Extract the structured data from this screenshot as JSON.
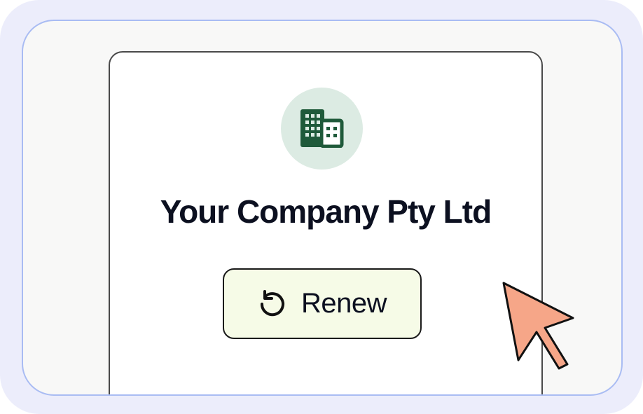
{
  "card": {
    "icon": "building-icon",
    "company_name": "Your Company Pty Ltd",
    "renew_button": {
      "label": "Renew",
      "icon": "rotate-ccw-icon"
    }
  },
  "pointer": {
    "icon": "mouse-pointer-icon",
    "color": "#f6a688"
  },
  "colors": {
    "frame_background": "#ecedfb",
    "frame_border": "#a9bcf3",
    "avatar_background": "#dcebe3",
    "building_icon": "#1f5a3a",
    "button_background": "#f6fbe7",
    "text": "#0c1020"
  }
}
